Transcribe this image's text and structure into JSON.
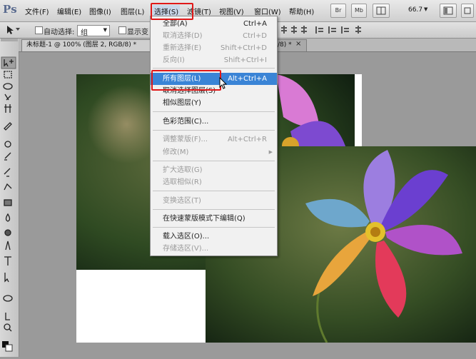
{
  "app": {
    "logo": "Ps"
  },
  "menubar": {
    "items": [
      "文件(F)",
      "编辑(E)",
      "图像(I)",
      "图层(L)",
      "选择(S)",
      "滤镜(T)",
      "视图(V)",
      "窗口(W)",
      "帮助(H)"
    ],
    "bridge": "Br",
    "minibridge": "Mb",
    "zoom": "66.7"
  },
  "options": {
    "auto_select_label": "自动选择:",
    "auto_select_value": "组",
    "show_transform_label": "显示变"
  },
  "tabs": [
    {
      "label": "未标题-1 @ 100% (图层 2, RGB/8) *"
    },
    {
      "label": "/8) *"
    }
  ],
  "select_menu": {
    "items": [
      {
        "label": "全部(A)",
        "shortcut": "Ctrl+A",
        "enabled": true
      },
      {
        "label": "取消选择(D)",
        "shortcut": "Ctrl+D",
        "enabled": false
      },
      {
        "label": "重新选择(E)",
        "shortcut": "Shift+Ctrl+D",
        "enabled": false
      },
      {
        "label": "反向(I)",
        "shortcut": "Shift+Ctrl+I",
        "enabled": false
      },
      {
        "label": "所有图层(L)",
        "shortcut": "Alt+Ctrl+A",
        "enabled": true,
        "highlighted": true
      },
      {
        "label": "取消选择图层(S)",
        "shortcut": "",
        "enabled": true
      },
      {
        "label": "相似图层(Y)",
        "shortcut": "",
        "enabled": true
      },
      {
        "label": "色彩范围(C)...",
        "shortcut": "",
        "enabled": true
      },
      {
        "label": "调整蒙版(F)...",
        "shortcut": "Alt+Ctrl+R",
        "enabled": false
      },
      {
        "label": "修改(M)",
        "shortcut": "",
        "enabled": false,
        "submenu": true
      },
      {
        "label": "扩大选取(G)",
        "shortcut": "",
        "enabled": false
      },
      {
        "label": "选取相似(R)",
        "shortcut": "",
        "enabled": false
      },
      {
        "label": "变换选区(T)",
        "shortcut": "",
        "enabled": false
      },
      {
        "label": "在快速蒙版模式下编辑(Q)",
        "shortcut": "",
        "enabled": true
      },
      {
        "label": "载入选区(O)...",
        "shortcut": "",
        "enabled": true
      },
      {
        "label": "存储选区(V)...",
        "shortcut": "",
        "enabled": false
      }
    ]
  },
  "colors": {
    "highlight": "#3a84d6",
    "annotation": "#e01818",
    "menu_bg": "#f1f1f1"
  }
}
